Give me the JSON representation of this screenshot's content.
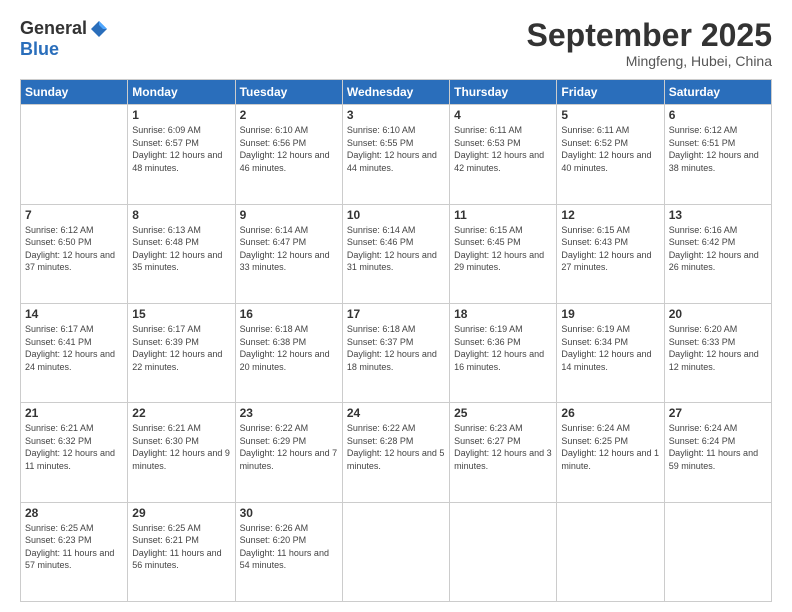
{
  "logo": {
    "general": "General",
    "blue": "Blue"
  },
  "header": {
    "month": "September 2025",
    "location": "Mingfeng, Hubei, China"
  },
  "days_of_week": [
    "Sunday",
    "Monday",
    "Tuesday",
    "Wednesday",
    "Thursday",
    "Friday",
    "Saturday"
  ],
  "weeks": [
    [
      {
        "day": "",
        "sunrise": "",
        "sunset": "",
        "daylight": ""
      },
      {
        "day": "1",
        "sunrise": "Sunrise: 6:09 AM",
        "sunset": "Sunset: 6:57 PM",
        "daylight": "Daylight: 12 hours and 48 minutes."
      },
      {
        "day": "2",
        "sunrise": "Sunrise: 6:10 AM",
        "sunset": "Sunset: 6:56 PM",
        "daylight": "Daylight: 12 hours and 46 minutes."
      },
      {
        "day": "3",
        "sunrise": "Sunrise: 6:10 AM",
        "sunset": "Sunset: 6:55 PM",
        "daylight": "Daylight: 12 hours and 44 minutes."
      },
      {
        "day": "4",
        "sunrise": "Sunrise: 6:11 AM",
        "sunset": "Sunset: 6:53 PM",
        "daylight": "Daylight: 12 hours and 42 minutes."
      },
      {
        "day": "5",
        "sunrise": "Sunrise: 6:11 AM",
        "sunset": "Sunset: 6:52 PM",
        "daylight": "Daylight: 12 hours and 40 minutes."
      },
      {
        "day": "6",
        "sunrise": "Sunrise: 6:12 AM",
        "sunset": "Sunset: 6:51 PM",
        "daylight": "Daylight: 12 hours and 38 minutes."
      }
    ],
    [
      {
        "day": "7",
        "sunrise": "Sunrise: 6:12 AM",
        "sunset": "Sunset: 6:50 PM",
        "daylight": "Daylight: 12 hours and 37 minutes."
      },
      {
        "day": "8",
        "sunrise": "Sunrise: 6:13 AM",
        "sunset": "Sunset: 6:48 PM",
        "daylight": "Daylight: 12 hours and 35 minutes."
      },
      {
        "day": "9",
        "sunrise": "Sunrise: 6:14 AM",
        "sunset": "Sunset: 6:47 PM",
        "daylight": "Daylight: 12 hours and 33 minutes."
      },
      {
        "day": "10",
        "sunrise": "Sunrise: 6:14 AM",
        "sunset": "Sunset: 6:46 PM",
        "daylight": "Daylight: 12 hours and 31 minutes."
      },
      {
        "day": "11",
        "sunrise": "Sunrise: 6:15 AM",
        "sunset": "Sunset: 6:45 PM",
        "daylight": "Daylight: 12 hours and 29 minutes."
      },
      {
        "day": "12",
        "sunrise": "Sunrise: 6:15 AM",
        "sunset": "Sunset: 6:43 PM",
        "daylight": "Daylight: 12 hours and 27 minutes."
      },
      {
        "day": "13",
        "sunrise": "Sunrise: 6:16 AM",
        "sunset": "Sunset: 6:42 PM",
        "daylight": "Daylight: 12 hours and 26 minutes."
      }
    ],
    [
      {
        "day": "14",
        "sunrise": "Sunrise: 6:17 AM",
        "sunset": "Sunset: 6:41 PM",
        "daylight": "Daylight: 12 hours and 24 minutes."
      },
      {
        "day": "15",
        "sunrise": "Sunrise: 6:17 AM",
        "sunset": "Sunset: 6:39 PM",
        "daylight": "Daylight: 12 hours and 22 minutes."
      },
      {
        "day": "16",
        "sunrise": "Sunrise: 6:18 AM",
        "sunset": "Sunset: 6:38 PM",
        "daylight": "Daylight: 12 hours and 20 minutes."
      },
      {
        "day": "17",
        "sunrise": "Sunrise: 6:18 AM",
        "sunset": "Sunset: 6:37 PM",
        "daylight": "Daylight: 12 hours and 18 minutes."
      },
      {
        "day": "18",
        "sunrise": "Sunrise: 6:19 AM",
        "sunset": "Sunset: 6:36 PM",
        "daylight": "Daylight: 12 hours and 16 minutes."
      },
      {
        "day": "19",
        "sunrise": "Sunrise: 6:19 AM",
        "sunset": "Sunset: 6:34 PM",
        "daylight": "Daylight: 12 hours and 14 minutes."
      },
      {
        "day": "20",
        "sunrise": "Sunrise: 6:20 AM",
        "sunset": "Sunset: 6:33 PM",
        "daylight": "Daylight: 12 hours and 12 minutes."
      }
    ],
    [
      {
        "day": "21",
        "sunrise": "Sunrise: 6:21 AM",
        "sunset": "Sunset: 6:32 PM",
        "daylight": "Daylight: 12 hours and 11 minutes."
      },
      {
        "day": "22",
        "sunrise": "Sunrise: 6:21 AM",
        "sunset": "Sunset: 6:30 PM",
        "daylight": "Daylight: 12 hours and 9 minutes."
      },
      {
        "day": "23",
        "sunrise": "Sunrise: 6:22 AM",
        "sunset": "Sunset: 6:29 PM",
        "daylight": "Daylight: 12 hours and 7 minutes."
      },
      {
        "day": "24",
        "sunrise": "Sunrise: 6:22 AM",
        "sunset": "Sunset: 6:28 PM",
        "daylight": "Daylight: 12 hours and 5 minutes."
      },
      {
        "day": "25",
        "sunrise": "Sunrise: 6:23 AM",
        "sunset": "Sunset: 6:27 PM",
        "daylight": "Daylight: 12 hours and 3 minutes."
      },
      {
        "day": "26",
        "sunrise": "Sunrise: 6:24 AM",
        "sunset": "Sunset: 6:25 PM",
        "daylight": "Daylight: 12 hours and 1 minute."
      },
      {
        "day": "27",
        "sunrise": "Sunrise: 6:24 AM",
        "sunset": "Sunset: 6:24 PM",
        "daylight": "Daylight: 11 hours and 59 minutes."
      }
    ],
    [
      {
        "day": "28",
        "sunrise": "Sunrise: 6:25 AM",
        "sunset": "Sunset: 6:23 PM",
        "daylight": "Daylight: 11 hours and 57 minutes."
      },
      {
        "day": "29",
        "sunrise": "Sunrise: 6:25 AM",
        "sunset": "Sunset: 6:21 PM",
        "daylight": "Daylight: 11 hours and 56 minutes."
      },
      {
        "day": "30",
        "sunrise": "Sunrise: 6:26 AM",
        "sunset": "Sunset: 6:20 PM",
        "daylight": "Daylight: 11 hours and 54 minutes."
      },
      {
        "day": "",
        "sunrise": "",
        "sunset": "",
        "daylight": ""
      },
      {
        "day": "",
        "sunrise": "",
        "sunset": "",
        "daylight": ""
      },
      {
        "day": "",
        "sunrise": "",
        "sunset": "",
        "daylight": ""
      },
      {
        "day": "",
        "sunrise": "",
        "sunset": "",
        "daylight": ""
      }
    ]
  ]
}
